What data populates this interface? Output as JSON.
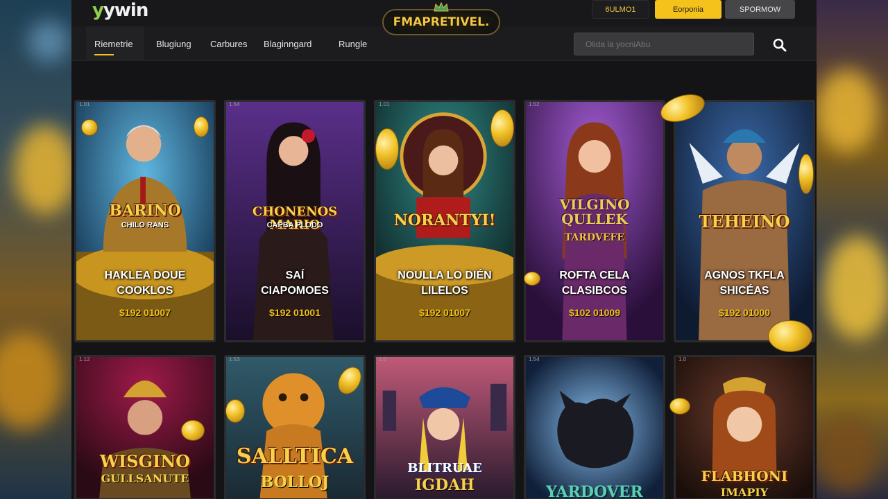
{
  "header": {
    "logo": "yywin",
    "center_badge": "FMAPRETIVEL.",
    "buttons": {
      "login": "6ULMO1",
      "register": "Eorponia",
      "promo": "SPORMOW"
    }
  },
  "nav": {
    "items": [
      {
        "label": "Riemetrie",
        "active": true
      },
      {
        "label": "Blugiung",
        "active": false
      },
      {
        "label": "Carbures",
        "active": false
      },
      {
        "label": "Blaginngard",
        "active": false
      },
      {
        "label": "Rungle",
        "active": false
      }
    ],
    "search_placeholder": "Olida la yocniAbu"
  },
  "games": [
    {
      "id": "1.01",
      "title": "BARINO",
      "subtitle": "CHILO RANS",
      "name_line1": "HAKLEA DOUE",
      "name_line2": "COOKLOS",
      "price": "$192 01007",
      "theme": "#1e5d86"
    },
    {
      "id": "1.54",
      "title": "CHONENOS MARIO",
      "subtitle": "CAPBA PLODO",
      "name_line1": "SAÍ",
      "name_line2": "CIAPOMOES",
      "price": "$192 01001",
      "theme": "#3b1f58"
    },
    {
      "id": "1.01",
      "title": "NORANTYI!",
      "subtitle": "",
      "name_line1": "NOULLA LO DIÉN",
      "name_line2": "LILELOS",
      "price": "$192 01007",
      "theme": "#16464a"
    },
    {
      "id": "1.52",
      "title": "VILGINO QULLEK",
      "subtitle": "TARDVEFE",
      "name_line1": "ROFTA CELA",
      "name_line2": "CLASIBCOS",
      "price": "$102 01009",
      "theme": "#4a1f5e"
    },
    {
      "id": "1.01",
      "title": "TEHEINO",
      "subtitle": "",
      "name_line1": "AGNOS TKFLA",
      "name_line2": "SHICÉAS",
      "price": "$192 01000",
      "theme": "#1e3c66"
    },
    {
      "id": "1.12",
      "title": "WISGINO",
      "subtitle": "GULLSANUTE",
      "theme": "#6a1a3a"
    },
    {
      "id": "1.53",
      "title": "SALLTICA",
      "subtitle": "BOLLOJ",
      "theme": "#2a3e4e"
    },
    {
      "id": "1.0",
      "title": "BLITRUAE",
      "subtitle": "IGDAH",
      "theme": "#3a2e4e"
    },
    {
      "id": "1.54",
      "title": "",
      "subtitle": "YARDOVER",
      "theme": "#17325a"
    },
    {
      "id": "1.0",
      "title": "FLABHONI",
      "subtitle": "IMAPIY",
      "theme": "#3a2520"
    }
  ],
  "colors": {
    "accent": "#f4c21a",
    "background": "#141416",
    "nav": "#1c1c1e"
  }
}
